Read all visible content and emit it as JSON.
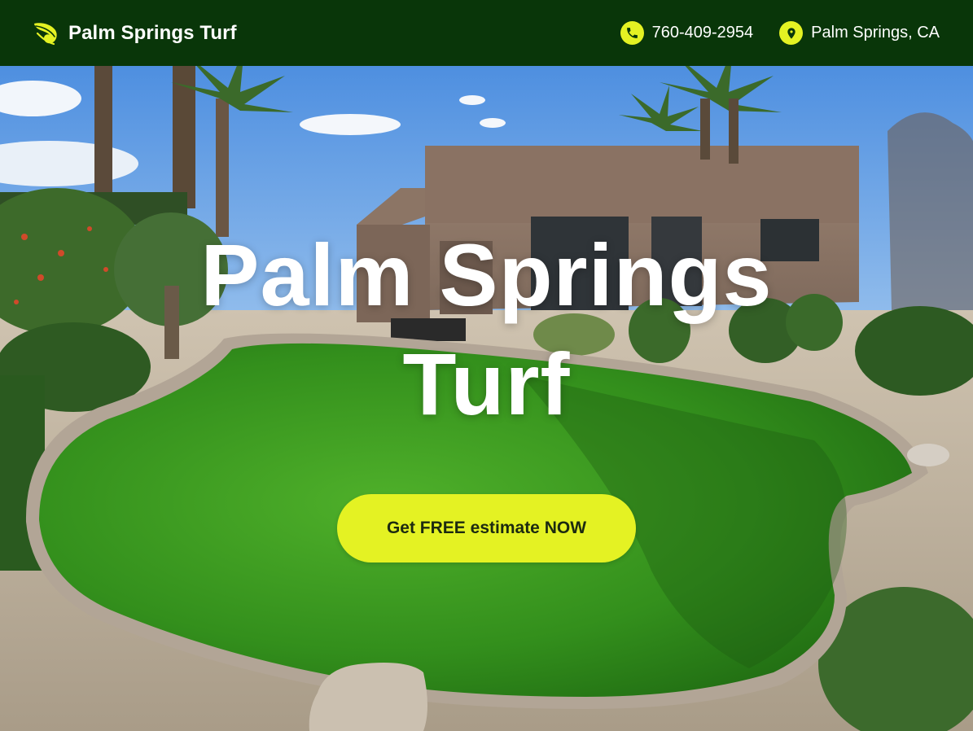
{
  "header": {
    "brand_name": "Palm Springs Turf",
    "logo_icon": "leaf-icon",
    "phone": "760-409-2954",
    "phone_icon": "phone-icon",
    "location": "Palm Springs, CA",
    "location_icon": "map-pin-icon"
  },
  "hero": {
    "title_line1": "Palm Springs",
    "title_line2": "Turf",
    "cta_label": "Get FREE estimate NOW",
    "image_subject": "photo"
  },
  "colors": {
    "header_bg": "#093609",
    "accent": "#e4f223",
    "text_light": "#ffffff",
    "button_text": "#1c2a10"
  }
}
